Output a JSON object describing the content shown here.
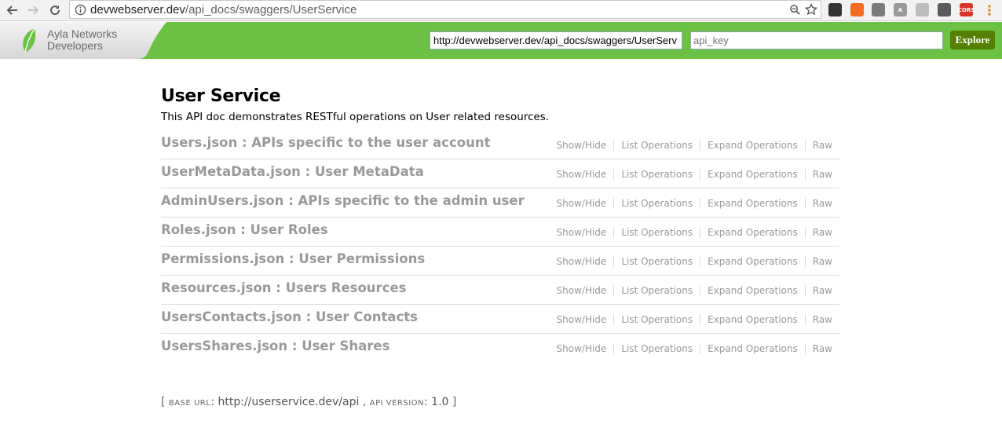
{
  "browser": {
    "url_host": "devwebserver.dev",
    "url_path": "/api_docs/swaggers/UserService",
    "extensions": [
      {
        "name": "puzzle-icon",
        "color": "#333333",
        "label": ""
      },
      {
        "name": "extension-orange-icon",
        "color": "#f36c21",
        "label": ""
      },
      {
        "name": "extension-gray-icon",
        "color": "#7a7a7a",
        "label": ""
      },
      {
        "name": "extension-a-icon",
        "color": "#9a9a9a",
        "label": "A"
      },
      {
        "name": "drive-icon",
        "color": "#bdbdbd",
        "label": ""
      },
      {
        "name": "extension-pin-icon",
        "color": "#5a5a5a",
        "label": ""
      },
      {
        "name": "cors-icon",
        "color": "#d9342b",
        "label": "CORS"
      }
    ]
  },
  "header": {
    "logo_line1": "Ayla Networks",
    "logo_line2": "Developers",
    "api_url_value": "http://devwebserver.dev/api_docs/swaggers/UserServ",
    "api_key_placeholder": "api_key",
    "explore_label": "Explore",
    "colors": {
      "bar": "#6cc043",
      "button": "#547f00"
    }
  },
  "page": {
    "title": "User Service",
    "description": "This API doc demonstrates RESTful operations on User related resources."
  },
  "operations_labels": {
    "show_hide": "Show/Hide",
    "list": "List Operations",
    "expand": "Expand Operations",
    "raw": "Raw"
  },
  "resources": [
    {
      "title": "Users.json : APIs specific to the user account"
    },
    {
      "title": "UserMetaData.json : User MetaData"
    },
    {
      "title": "AdminUsers.json : APIs specific to the admin user"
    },
    {
      "title": "Roles.json : User Roles"
    },
    {
      "title": "Permissions.json : User Permissions"
    },
    {
      "title": "Resources.json : Users Resources"
    },
    {
      "title": "UsersContacts.json : User Contacts"
    },
    {
      "title": "UsersShares.json : User Shares"
    }
  ],
  "footer": {
    "open": "[ ",
    "base_url_label": "BASE URL",
    "base_url": "http://userservice.dev/api",
    "sep": " , ",
    "api_version_label": "API VERSION",
    "api_version": "1.0",
    "close": " ]"
  }
}
